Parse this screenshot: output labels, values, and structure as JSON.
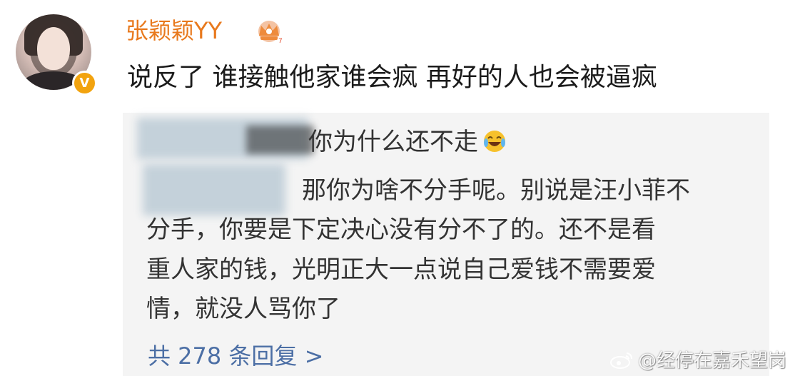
{
  "post": {
    "username": "张颖颖YY",
    "comment": "说反了 谁接触他家谁会疯 再好的人也会被逼疯",
    "badge_icon": "verified-v-icon",
    "crown_icon": "crown-icon",
    "name_color": "#e8791d"
  },
  "replies": {
    "line1": "你为什么还不走",
    "line1_emoji": "laughing-tears-emoji",
    "line2": "那你为啥不分手呢。别说是汪小菲不",
    "line3": "分手，你要是下定决心没有分不了的。还不是看",
    "line4": "重人家的钱，光明正大一点说自己爱钱不需要爱",
    "line5": "情，就没人骂你了",
    "count_label": "共 278 条回复 >",
    "link_color": "#4c6fa5"
  },
  "watermark": {
    "text": "@经停在嘉禾望岗"
  }
}
